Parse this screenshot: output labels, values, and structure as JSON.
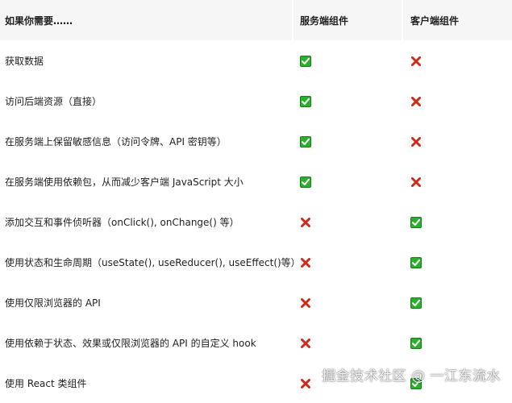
{
  "header": {
    "col1": "如果你需要……",
    "col2": "服务端组件",
    "col3": "客户端组件"
  },
  "rows": [
    {
      "label": "获取数据",
      "server": "check-icon",
      "client": "cross-icon"
    },
    {
      "label": "访问后端资源（直接）",
      "server": "check-icon",
      "client": "cross-icon"
    },
    {
      "label": "在服务端上保留敏感信息（访问令牌、API 密钥等）",
      "server": "check-icon",
      "client": "cross-icon"
    },
    {
      "label": "在服务端使用依赖包，从而减少客户端 JavaScript 大小",
      "server": "check-icon",
      "client": "cross-icon"
    },
    {
      "label": "添加交互和事件侦听器（onClick(), onChange() 等）",
      "server": "cross-icon",
      "client": "check-icon"
    },
    {
      "label": "使用状态和生命周期（useState(), useReducer(), useEffect()等）",
      "server": "cross-icon",
      "client": "check-icon"
    },
    {
      "label": "使用仅限浏览器的 API",
      "server": "cross-icon",
      "client": "check-icon"
    },
    {
      "label": "使用依赖于状态、效果或仅限浏览器的 API 的自定义 hook",
      "server": "cross-icon",
      "client": "check-icon"
    },
    {
      "label": "使用 React 类组件",
      "server": "cross-icon",
      "client": "check-icon"
    }
  ],
  "watermark": "掘金技术社区 @ 一江东流水",
  "colors": {
    "check_fill": "#2bb02d",
    "cross_stroke": "#cc2a1a",
    "header_bg": "#f6f6f7"
  }
}
